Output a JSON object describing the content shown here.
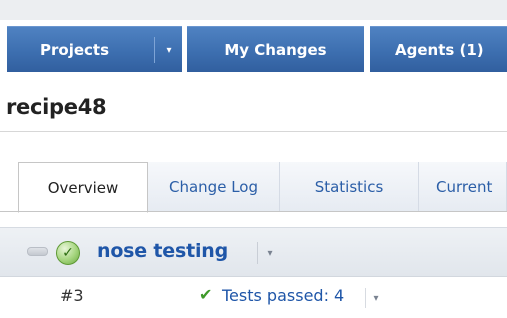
{
  "nav": {
    "projects_label": "Projects",
    "projects_dropdown_glyph": "▾",
    "my_changes_label": "My Changes",
    "agents_label": "Agents (1)"
  },
  "build": {
    "title": "recipe48"
  },
  "tabs": [
    {
      "label": "Overview",
      "active": true
    },
    {
      "label": "Change Log",
      "active": false
    },
    {
      "label": "Statistics",
      "active": false
    },
    {
      "label": "Current",
      "active": false
    }
  ],
  "configuration": {
    "name": "nose testing",
    "status_icon": "success-check-icon",
    "dropdown_glyph": "▾"
  },
  "builds": [
    {
      "number": "#3",
      "status": "Tests passed: 4",
      "status_icon": "checkmark-icon",
      "dropdown_glyph": "▾"
    }
  ],
  "colors": {
    "nav_tab": "#3d6fb0",
    "link": "#1f56a8",
    "success": "#3f9a2a"
  }
}
